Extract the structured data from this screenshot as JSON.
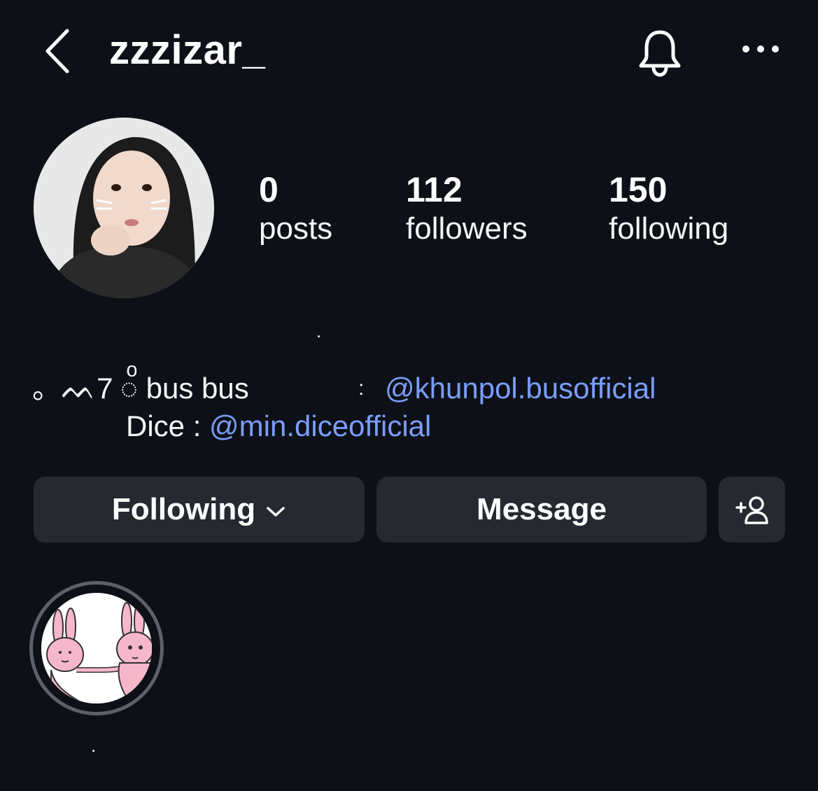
{
  "header": {
    "username": "zzzizar_"
  },
  "stats": {
    "posts_count": "0",
    "posts_label": "posts",
    "followers_count": "112",
    "followers_label": "followers",
    "following_count": "150",
    "following_label": "following"
  },
  "profile": {
    "name": "."
  },
  "bio": {
    "line1_prefix": "。ᨓ7",
    "line1_bus": "◌ͦ bus bus",
    "line1_colon": ":",
    "mention1": "@khunpol.busofficial",
    "line2_prefix": "Dice : ",
    "mention2": "@min.diceofficial"
  },
  "actions": {
    "following_label": "Following",
    "message_label": "Message"
  },
  "highlights": [
    {
      "label": "."
    }
  ],
  "colors": {
    "background": "#0d1117",
    "button": "#262a30",
    "link": "#7b9dfa",
    "highlight_ring": "#5c6068"
  }
}
